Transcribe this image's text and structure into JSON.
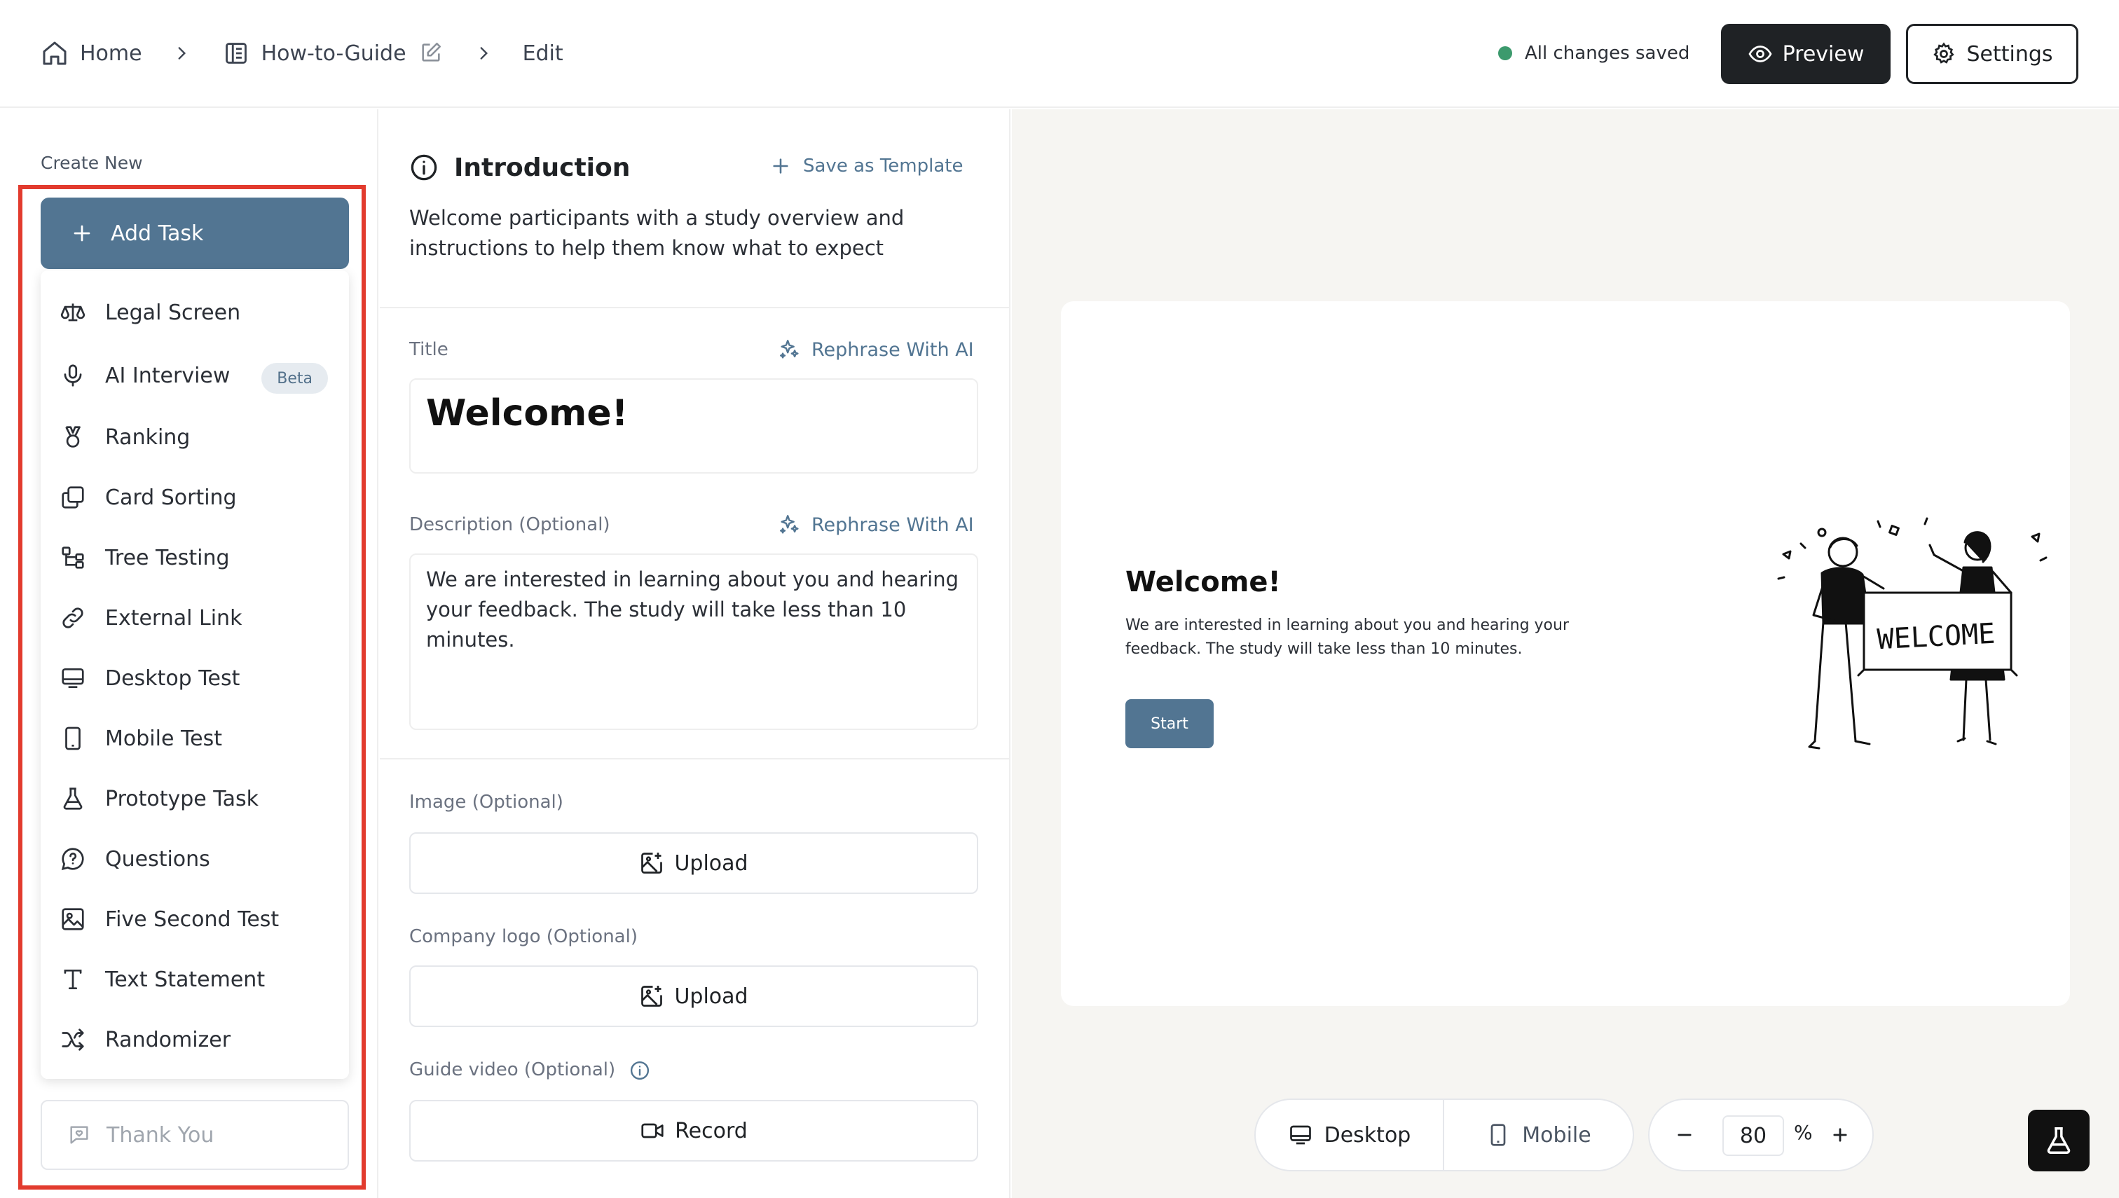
{
  "topbar": {
    "breadcrumb": {
      "home": "Home",
      "guide": "How-to-Guide",
      "current": "Edit"
    },
    "status": "All changes saved",
    "preview_label": "Preview",
    "settings_label": "Settings"
  },
  "sidebar": {
    "section_label": "Create New",
    "add_task_label": "Add Task",
    "items": [
      {
        "label": "Legal Screen",
        "icon": "scale-icon"
      },
      {
        "label": "AI Interview",
        "icon": "microphone-icon",
        "badge": "Beta"
      },
      {
        "label": "Ranking",
        "icon": "medal-icon"
      },
      {
        "label": "Card Sorting",
        "icon": "cards-icon"
      },
      {
        "label": "Tree Testing",
        "icon": "tree-icon"
      },
      {
        "label": "External Link",
        "icon": "link-icon"
      },
      {
        "label": "Desktop Test",
        "icon": "monitor-icon"
      },
      {
        "label": "Mobile Test",
        "icon": "phone-icon"
      },
      {
        "label": "Prototype Task",
        "icon": "flask-icon"
      },
      {
        "label": "Questions",
        "icon": "question-bubble-icon"
      },
      {
        "label": "Five Second Test",
        "icon": "image-icon"
      },
      {
        "label": "Text Statement",
        "icon": "text-icon"
      },
      {
        "label": "Randomizer",
        "icon": "shuffle-icon"
      }
    ],
    "thank_you_label": "Thank You"
  },
  "editor": {
    "heading": "Introduction",
    "save_template_label": "Save as Template",
    "intro_description": "Welcome participants with a study overview and instructions to help them know what to expect",
    "title_label": "Title",
    "rephrase_label": "Rephrase With AI",
    "title_value": "Welcome!",
    "description_label": "Description (Optional)",
    "description_value": "We are interested in learning about you and hearing your feedback. The study will take less than 10 minutes.",
    "image_label": "Image (Optional)",
    "upload_label": "Upload",
    "logo_label": "Company logo (Optional)",
    "video_label": "Guide video (Optional)",
    "record_label": "Record"
  },
  "preview": {
    "title": "Welcome!",
    "description": "We are interested in learning about you and hearing your feedback. The study will take less than 10 minutes.",
    "start_label": "Start",
    "illustration_sign": "WELCOME",
    "desktop_label": "Desktop",
    "mobile_label": "Mobile",
    "zoom_value": "80",
    "zoom_unit": "%"
  },
  "colors": {
    "accent": "#527592",
    "highlight_border": "#e23b2e",
    "saved_dot": "#3c9a6d",
    "dark_button": "#1f2225",
    "preview_bg": "#f6f5f2"
  }
}
